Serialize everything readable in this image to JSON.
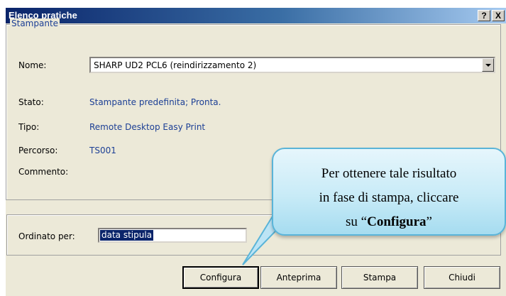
{
  "window": {
    "title": "Elenco pratiche",
    "help_label": "?",
    "close_label": "X"
  },
  "printer_group": {
    "legend": "Stampante",
    "name_label": "Nome:",
    "name_value": "SHARP UD2 PCL6 (reindirizzamento 2)",
    "status_label": "Stato:",
    "status_value": "Stampante predefinita; Pronta.",
    "type_label": "Tipo:",
    "type_value": "Remote Desktop Easy Print",
    "path_label": "Percorso:",
    "path_value": "TS001",
    "comment_label": "Commento:",
    "comment_value": ""
  },
  "sort": {
    "label": "Ordinato per:",
    "value": "data stipula"
  },
  "buttons": {
    "configure": "Configura",
    "preview": "Anteprima",
    "print": "Stampa",
    "close": "Chiudi"
  },
  "callout": {
    "line1": "Per ottenere tale risultato",
    "line2": "in fase di stampa, cliccare",
    "line3_prefix": "su “",
    "line3_bold": "Configura",
    "line3_suffix": "”"
  },
  "colors": {
    "dialog_bg": "#ece9d8",
    "title_gradient_start": "#0a246a",
    "accent_text": "#1c3f95",
    "callout_border": "#5ab4d8"
  }
}
